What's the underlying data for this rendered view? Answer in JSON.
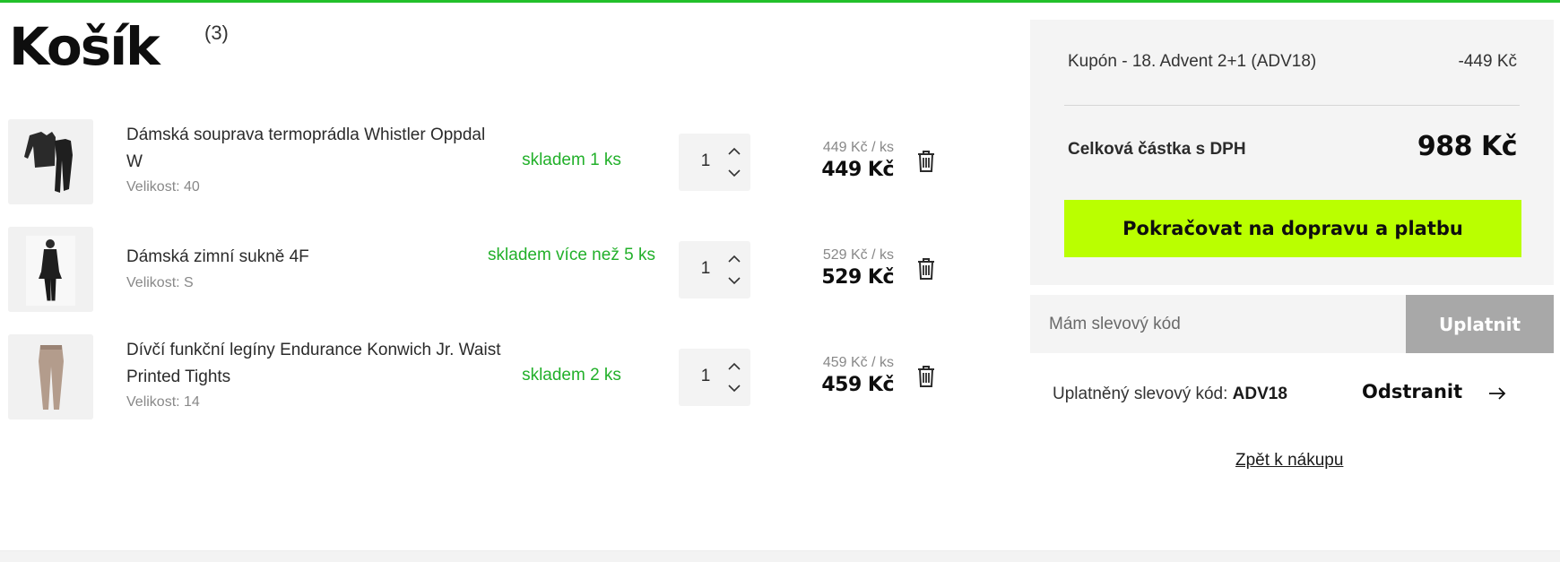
{
  "page": {
    "title": "Košík",
    "count": "(3)"
  },
  "items": [
    {
      "name": "Dámská souprava termoprádla Whistler Oppdal W",
      "size": "Velikost: 40",
      "stock": "skladem 1 ks",
      "quantity": "1",
      "unit_price": "449 Kč / ks",
      "price": "449 Kč",
      "image_icon": "thermal-underwear-set-image"
    },
    {
      "name": "Dámská zimní sukně 4F",
      "size": "Velikost: S",
      "stock": "skladem více než 5 ks",
      "quantity": "1",
      "unit_price": "529 Kč / ks",
      "price": "529 Kč",
      "image_icon": "winter-skirt-image"
    },
    {
      "name": "Dívčí funkční legíny Endurance Konwich Jr. Waist Printed Tights",
      "size": "Velikost: 14",
      "stock": "skladem 2 ks",
      "quantity": "1",
      "unit_price": "459 Kč / ks",
      "price": "459 Kč",
      "image_icon": "leggings-image"
    }
  ],
  "summary": {
    "coupon_label": "Kupón - 18. Advent 2+1 (ADV18)",
    "coupon_value": "-449 Kč",
    "total_label": "Celková částka s DPH",
    "total_value": "988 Kč",
    "cta_label": "Pokračovat na dopravu a platbu"
  },
  "discount": {
    "placeholder": "Mám slevový kód",
    "apply_label": "Uplatnit",
    "applied_label": "Uplatněný slevový kód:",
    "applied_code": "ADV18",
    "remove_label": "Odstranit"
  },
  "back_label": "Zpět k nákupu",
  "colors": {
    "accent_top_line": "#22c02a",
    "stock_green": "#22b02a",
    "cta_lime": "#baff00",
    "apply_gray": "#a8a8a8",
    "panel_gray": "#f4f4f4"
  },
  "icons": {
    "trash": "trash-icon",
    "qty_up": "chevron-up-icon",
    "qty_down": "chevron-down-icon",
    "remove_arrow": "arrow-right-icon"
  }
}
